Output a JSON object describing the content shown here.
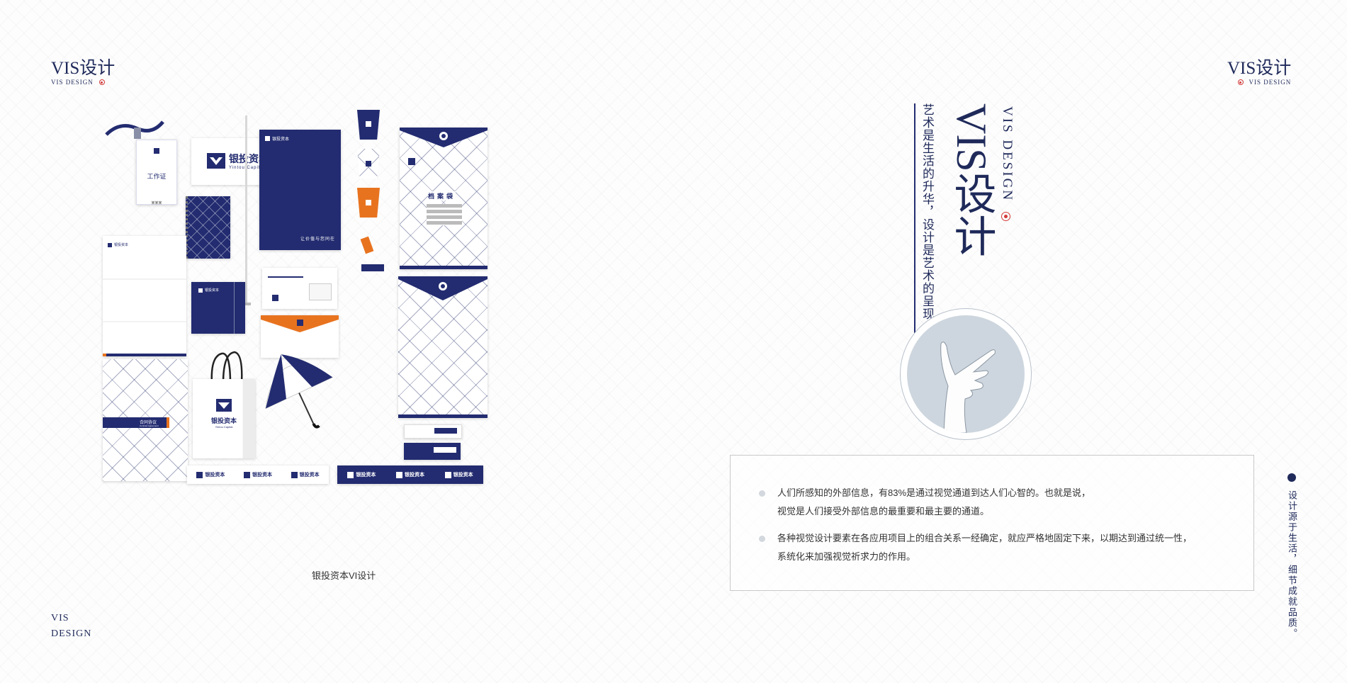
{
  "corner_left": {
    "title": "VIS设计",
    "sub": "VIS DESIGN"
  },
  "corner_right": {
    "title": "VIS设计",
    "sub": "VIS DESIGN"
  },
  "bottom_left": {
    "line1": "VIS",
    "line2": "DESIGN"
  },
  "brand": {
    "name_cn": "银投资本",
    "name_en": "Yintou Capital",
    "id_card": "工作证",
    "contract_cn": "合同协议",
    "contract_en": "Contract Agreement",
    "archive_bag": "档案袋",
    "slogan": "让价值与您同在",
    "card_name": "某某某"
  },
  "caption": "银投资本VI设计",
  "hero": {
    "vertical_en": "VIS DESIGN",
    "big_title": "VIS设计",
    "tagline": "艺术是生活的升华，设计是艺术的呈现。"
  },
  "info": {
    "items": [
      {
        "line1": "人们所感知的外部信息，有83%是通过视觉通道到达人们心智的。也就是说，",
        "line2": "视觉是人们接受外部信息的最重要和最主要的通道。"
      },
      {
        "line1": "各种视觉设计要素在各应用项目上的组合关系一经确定，就应严格地固定下来，以期达到通过统一性，",
        "line2": "系统化来加强视觉祈求力的作用。"
      }
    ]
  },
  "side_text": "设计源于生活，细节成就品质。",
  "colors": {
    "navy": "#232c70",
    "orange": "#e8731f",
    "red": "#d33a3a"
  }
}
